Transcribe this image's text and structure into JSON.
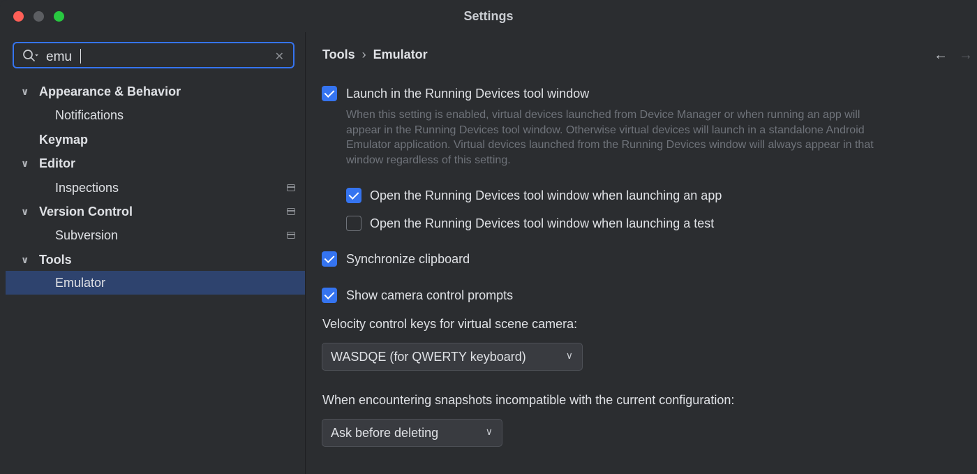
{
  "window": {
    "title": "Settings"
  },
  "sidebar": {
    "search": {
      "value": "emu"
    },
    "items": [
      {
        "label": "Appearance & Behavior",
        "expandable": true
      },
      {
        "label": "Notifications"
      },
      {
        "label": "Keymap"
      },
      {
        "label": "Editor",
        "expandable": true
      },
      {
        "label": "Inspections",
        "project_icon": true
      },
      {
        "label": "Version Control",
        "expandable": true,
        "project_icon": true
      },
      {
        "label": "Subversion",
        "project_icon": true
      },
      {
        "label": "Tools",
        "expandable": true
      },
      {
        "label": "Emulator",
        "selected": true
      }
    ]
  },
  "breadcrumb": {
    "parent": "Tools",
    "separator": "›",
    "current": "Emulator"
  },
  "nav": {
    "back": "←",
    "forward": "→"
  },
  "settings": {
    "launch_in_running_devices": {
      "label": "Launch in the Running Devices tool window",
      "checked": true,
      "description": "When this setting is enabled, virtual devices launched from Device Manager or when running an app will appear in the Running Devices tool window. Otherwise virtual devices will launch in a standalone Android Emulator application. Virtual devices launched from the Running Devices window will always appear in that window regardless of this setting."
    },
    "open_when_launching_app": {
      "label": "Open the Running Devices tool window when launching an app",
      "checked": true
    },
    "open_when_launching_test": {
      "label": "Open the Running Devices tool window when launching a test",
      "checked": false
    },
    "synchronize_clipboard": {
      "label": "Synchronize clipboard",
      "checked": true
    },
    "show_camera_prompts": {
      "label": "Show camera control prompts",
      "checked": true
    },
    "velocity_keys": {
      "label": "Velocity control keys for virtual scene camera:",
      "selected": "WASDQE (for QWERTY keyboard)"
    },
    "snapshots": {
      "label": "When encountering snapshots incompatible with the current configuration:",
      "selected": "Ask before deleting"
    }
  },
  "colors": {
    "accent": "#3574f0",
    "selection": "#2e436e",
    "background": "#2b2d30"
  }
}
